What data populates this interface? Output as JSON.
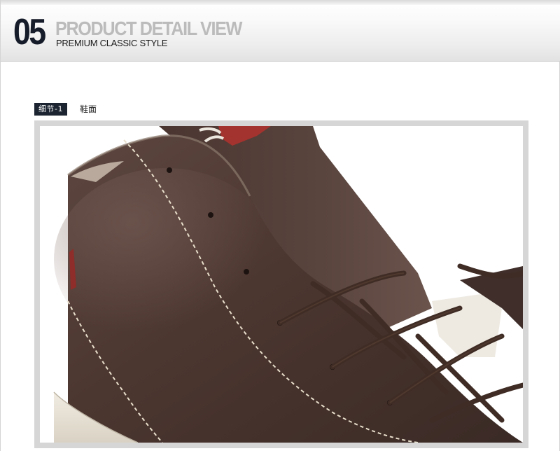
{
  "header": {
    "section_number": "05",
    "title": "PRODUCT DETAIL VIEW",
    "subtitle": "PREMIUM CLASSIC STYLE"
  },
  "detail": {
    "tag": "细节-1",
    "caption": "鞋面"
  },
  "photo": {
    "subject": "brown-leather-high-top-sneaker-closeup"
  },
  "colors": {
    "dark_navy": "#161c2a",
    "title_gray": "#bbbbbb",
    "leather_brown": "#4e3832",
    "lace_brown": "#3f2c24",
    "stitch_cream": "#e9dfcc",
    "heel_red": "#a3332e"
  }
}
